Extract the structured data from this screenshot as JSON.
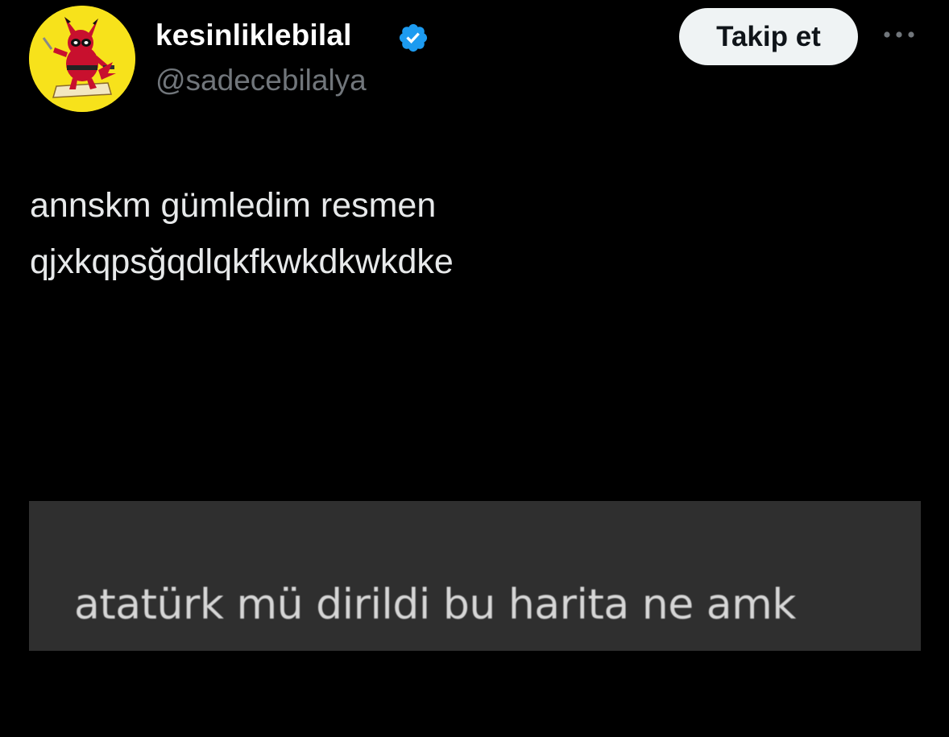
{
  "author": {
    "display_name": "kesinliklebilal",
    "handle": "@sadecebilalya",
    "verified": true,
    "avatar_icon": "pikachu-deadpool-avatar",
    "avatar_bg": "#f7e21b"
  },
  "actions": {
    "follow_label": "Takip et",
    "more_icon": "more-horizontal-icon"
  },
  "tweet": {
    "lines": [
      "annskm gümledim resmen",
      "qjxkqpsğqdlqkfkwkdkwkdke"
    ]
  },
  "media": {
    "caption": "atatürk mü dirildi bu harita ne amk",
    "background": "#2f2f2f"
  },
  "colors": {
    "background": "#000000",
    "text_primary": "#e7e9ea",
    "text_secondary": "#71767b",
    "verified_blue": "#1d9bf0"
  }
}
